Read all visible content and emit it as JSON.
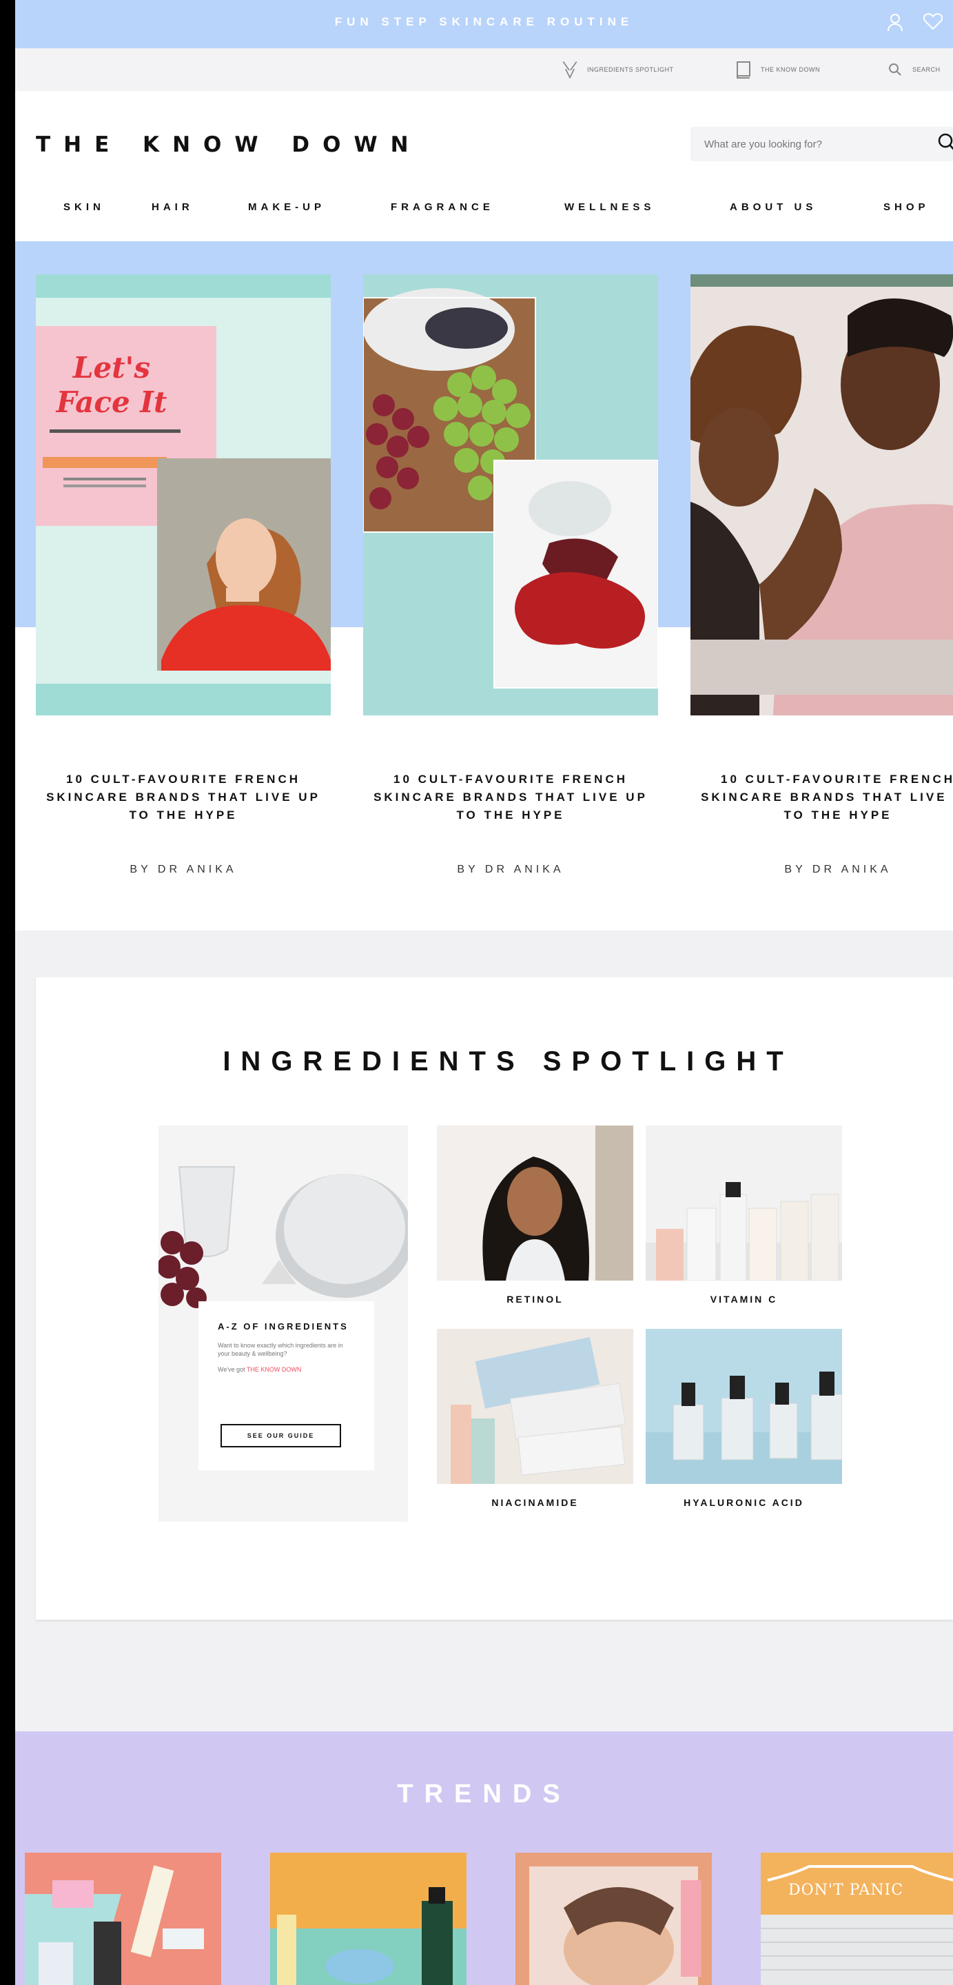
{
  "promo": {
    "text": "FUN STEP SKINCARE ROUTINE",
    "user_icon": "user-icon",
    "heart_icon": "heart-icon"
  },
  "utility": {
    "ingredients_label": "INGREDIENTS SPOTLIGHT",
    "glossary_label": "THE KNOW DOWN",
    "search_label": "SEARCH"
  },
  "header": {
    "logo": "THE KNOW DOWN",
    "search_placeholder": "What are you looking for?"
  },
  "nav": [
    "SKIN",
    "HAIR",
    "MAKE-UP",
    "FRAGRANCE",
    "WELLNESS",
    "ABOUT US",
    "SHOP"
  ],
  "hero": {
    "cards": [
      {
        "title": "10 CULT-FAVOURITE FRENCH SKINCARE BRANDS THAT LIVE UP TO THE HYPE",
        "author": "BY DR ANIKA",
        "book_title": "Let's Face It"
      },
      {
        "title": "10 CULT-FAVOURITE FRENCH SKINCARE BRANDS THAT LIVE UP TO THE HYPE",
        "author": "BY DR ANIKA"
      },
      {
        "title": "10 CULT-FAVOURITE FRENCH SKINCARE BRANDS THAT LIVE UP TO THE HYPE",
        "author": "BY DR ANIKA"
      }
    ]
  },
  "ingredients": {
    "title": "INGREDIENTS SPOTLIGHT",
    "az": {
      "heading": "A-Z OF INGREDIENTS",
      "text": "Want to know exactly which ingredients are in your beauty & wellbeing?",
      "text2_prefix": "We've got ",
      "text2_link": "THE KNOW DOWN",
      "button": "SEE OUR GUIDE"
    },
    "tiles": [
      "RETINOL",
      "VITAMIN C",
      "NIACINAMIDE",
      "HYALURONIC ACID"
    ]
  },
  "trends": {
    "title": "TRENDS",
    "card4_text": "DON'T PANIC"
  },
  "colors": {
    "promo": "#b9d4fb",
    "trends": "#d0c8f2",
    "link": "#f04c5c"
  }
}
